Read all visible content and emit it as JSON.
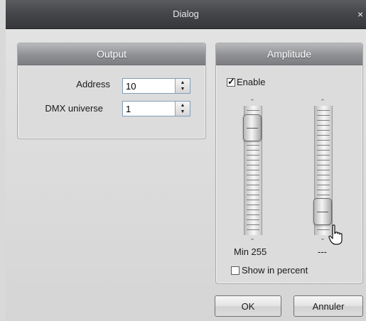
{
  "window": {
    "title": "Dialog",
    "close_glyph": "×"
  },
  "output": {
    "header": "Output",
    "address_label": "Address",
    "address_value": "10",
    "universe_label": "DMX universe",
    "universe_value": "1"
  },
  "amplitude": {
    "header": "Amplitude",
    "enable_label": "Enable",
    "enable_checked": true,
    "min_slider": {
      "value": 255,
      "label": "Min 255"
    },
    "max_slider": {
      "label": "---"
    },
    "show_percent_label": "Show in percent",
    "show_percent_checked": false
  },
  "buttons": {
    "ok_label": "OK",
    "cancel_label": "Annuler"
  },
  "icons": {
    "spin_up": "▲",
    "spin_down": "▼",
    "slider_up": "⌃",
    "slider_down": "⌄",
    "checkmark": "✓"
  }
}
